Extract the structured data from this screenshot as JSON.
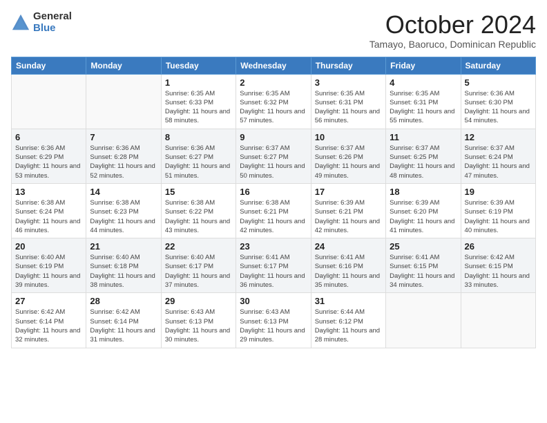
{
  "header": {
    "logo_general": "General",
    "logo_blue": "Blue",
    "month": "October 2024",
    "location": "Tamayo, Baoruco, Dominican Republic"
  },
  "weekdays": [
    "Sunday",
    "Monday",
    "Tuesday",
    "Wednesday",
    "Thursday",
    "Friday",
    "Saturday"
  ],
  "weeks": [
    [
      {
        "day": "",
        "info": ""
      },
      {
        "day": "",
        "info": ""
      },
      {
        "day": "1",
        "info": "Sunrise: 6:35 AM\nSunset: 6:33 PM\nDaylight: 11 hours and 58 minutes."
      },
      {
        "day": "2",
        "info": "Sunrise: 6:35 AM\nSunset: 6:32 PM\nDaylight: 11 hours and 57 minutes."
      },
      {
        "day": "3",
        "info": "Sunrise: 6:35 AM\nSunset: 6:31 PM\nDaylight: 11 hours and 56 minutes."
      },
      {
        "day": "4",
        "info": "Sunrise: 6:35 AM\nSunset: 6:31 PM\nDaylight: 11 hours and 55 minutes."
      },
      {
        "day": "5",
        "info": "Sunrise: 6:36 AM\nSunset: 6:30 PM\nDaylight: 11 hours and 54 minutes."
      }
    ],
    [
      {
        "day": "6",
        "info": "Sunrise: 6:36 AM\nSunset: 6:29 PM\nDaylight: 11 hours and 53 minutes."
      },
      {
        "day": "7",
        "info": "Sunrise: 6:36 AM\nSunset: 6:28 PM\nDaylight: 11 hours and 52 minutes."
      },
      {
        "day": "8",
        "info": "Sunrise: 6:36 AM\nSunset: 6:27 PM\nDaylight: 11 hours and 51 minutes."
      },
      {
        "day": "9",
        "info": "Sunrise: 6:37 AM\nSunset: 6:27 PM\nDaylight: 11 hours and 50 minutes."
      },
      {
        "day": "10",
        "info": "Sunrise: 6:37 AM\nSunset: 6:26 PM\nDaylight: 11 hours and 49 minutes."
      },
      {
        "day": "11",
        "info": "Sunrise: 6:37 AM\nSunset: 6:25 PM\nDaylight: 11 hours and 48 minutes."
      },
      {
        "day": "12",
        "info": "Sunrise: 6:37 AM\nSunset: 6:24 PM\nDaylight: 11 hours and 47 minutes."
      }
    ],
    [
      {
        "day": "13",
        "info": "Sunrise: 6:38 AM\nSunset: 6:24 PM\nDaylight: 11 hours and 46 minutes."
      },
      {
        "day": "14",
        "info": "Sunrise: 6:38 AM\nSunset: 6:23 PM\nDaylight: 11 hours and 44 minutes."
      },
      {
        "day": "15",
        "info": "Sunrise: 6:38 AM\nSunset: 6:22 PM\nDaylight: 11 hours and 43 minutes."
      },
      {
        "day": "16",
        "info": "Sunrise: 6:38 AM\nSunset: 6:21 PM\nDaylight: 11 hours and 42 minutes."
      },
      {
        "day": "17",
        "info": "Sunrise: 6:39 AM\nSunset: 6:21 PM\nDaylight: 11 hours and 42 minutes."
      },
      {
        "day": "18",
        "info": "Sunrise: 6:39 AM\nSunset: 6:20 PM\nDaylight: 11 hours and 41 minutes."
      },
      {
        "day": "19",
        "info": "Sunrise: 6:39 AM\nSunset: 6:19 PM\nDaylight: 11 hours and 40 minutes."
      }
    ],
    [
      {
        "day": "20",
        "info": "Sunrise: 6:40 AM\nSunset: 6:19 PM\nDaylight: 11 hours and 39 minutes."
      },
      {
        "day": "21",
        "info": "Sunrise: 6:40 AM\nSunset: 6:18 PM\nDaylight: 11 hours and 38 minutes."
      },
      {
        "day": "22",
        "info": "Sunrise: 6:40 AM\nSunset: 6:17 PM\nDaylight: 11 hours and 37 minutes."
      },
      {
        "day": "23",
        "info": "Sunrise: 6:41 AM\nSunset: 6:17 PM\nDaylight: 11 hours and 36 minutes."
      },
      {
        "day": "24",
        "info": "Sunrise: 6:41 AM\nSunset: 6:16 PM\nDaylight: 11 hours and 35 minutes."
      },
      {
        "day": "25",
        "info": "Sunrise: 6:41 AM\nSunset: 6:15 PM\nDaylight: 11 hours and 34 minutes."
      },
      {
        "day": "26",
        "info": "Sunrise: 6:42 AM\nSunset: 6:15 PM\nDaylight: 11 hours and 33 minutes."
      }
    ],
    [
      {
        "day": "27",
        "info": "Sunrise: 6:42 AM\nSunset: 6:14 PM\nDaylight: 11 hours and 32 minutes."
      },
      {
        "day": "28",
        "info": "Sunrise: 6:42 AM\nSunset: 6:14 PM\nDaylight: 11 hours and 31 minutes."
      },
      {
        "day": "29",
        "info": "Sunrise: 6:43 AM\nSunset: 6:13 PM\nDaylight: 11 hours and 30 minutes."
      },
      {
        "day": "30",
        "info": "Sunrise: 6:43 AM\nSunset: 6:13 PM\nDaylight: 11 hours and 29 minutes."
      },
      {
        "day": "31",
        "info": "Sunrise: 6:44 AM\nSunset: 6:12 PM\nDaylight: 11 hours and 28 minutes."
      },
      {
        "day": "",
        "info": ""
      },
      {
        "day": "",
        "info": ""
      }
    ]
  ]
}
